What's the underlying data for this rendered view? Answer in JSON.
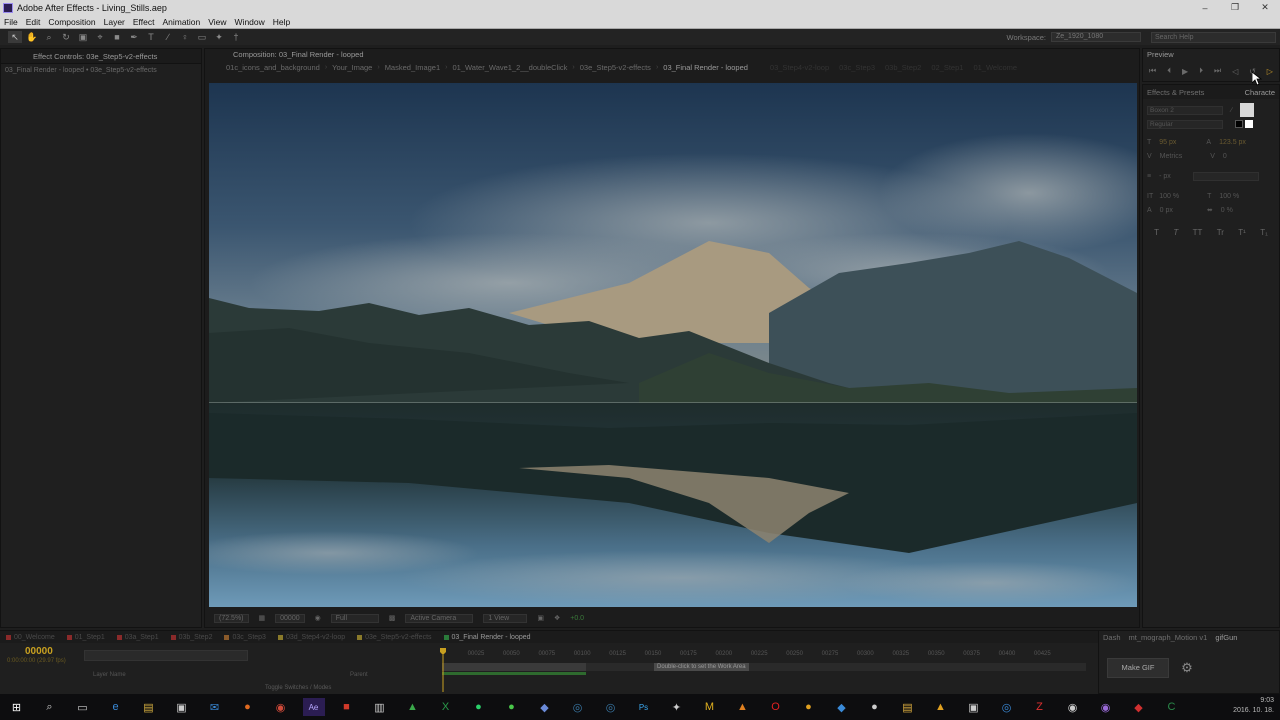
{
  "window": {
    "title": "Adobe After Effects - Living_Stills.aep",
    "controls": [
      "–",
      "❐",
      "✕"
    ]
  },
  "menu": [
    "File",
    "Edit",
    "Composition",
    "Layer",
    "Effect",
    "Animation",
    "View",
    "Window",
    "Help"
  ],
  "toolbar": {
    "workspace_label": "Workspace:",
    "workspace_value": "Ze_1920_1080",
    "search_placeholder": "Search Help"
  },
  "effect_controls": {
    "tab": "Effect Controls: 03e_Step5-v2-effects",
    "subtitle": "03_Final Render - looped • 03e_Step5-v2-effects"
  },
  "composition": {
    "tab": "Composition: 03_Final Render - looped",
    "breadcrumbs": [
      "01c_icons_and_background",
      "Your_Image",
      "Masked_Image1",
      "01_Water_Wave1_2__doubleClick",
      "03e_Step5-v2-effects",
      "03_Final Render - looped"
    ],
    "faded_crumbs": [
      "03_Step4-v2-loop",
      "03c_Step3",
      "03b_Step2",
      "02_Step1",
      "01_Welcome"
    ],
    "footer": {
      "zoom": "(72.5%)",
      "timecode": "00000",
      "resolution": "Full",
      "camera": "Active Camera",
      "views": "1 View",
      "exposure": "+0.0"
    }
  },
  "preview": {
    "tab": "Preview"
  },
  "character": {
    "tabs": [
      "Effects & Presets",
      "Characte"
    ],
    "font": "Boxon 2",
    "style": "Regular",
    "size": "95 px",
    "leading": "123.5 px",
    "kerning": "Metrics",
    "tracking": "0",
    "stroke_unit": "- px",
    "vscale": "100 %",
    "hscale": "100 %",
    "baseline": "0 px",
    "tsume": "0 %",
    "styles": [
      "T",
      "T",
      "TT",
      "Tr",
      "T¹",
      "T₁"
    ]
  },
  "timeline": {
    "tabs": [
      {
        "label": "00_Welcome",
        "color": "#8a2a2a"
      },
      {
        "label": "01_Step1",
        "color": "#8a2a2a"
      },
      {
        "label": "03a_Step1",
        "color": "#8a2a2a"
      },
      {
        "label": "03b_Step2",
        "color": "#8a2a2a"
      },
      {
        "label": "03c_Step3",
        "color": "#8a5a2a"
      },
      {
        "label": "03d_Step4-v2-loop",
        "color": "#8a7a2a"
      },
      {
        "label": "03e_Step5-v2-effects",
        "color": "#8a7a2a"
      },
      {
        "label": "03_Final Render - looped",
        "color": "#2a7a3a"
      }
    ],
    "timecode": "00000",
    "timecode_sub": "0:00:00:00 (29.97 fps)",
    "ruler": [
      "00025",
      "00050",
      "00075",
      "00100",
      "00125",
      "00150",
      "00175",
      "00200",
      "00225",
      "00250",
      "00275",
      "00300",
      "00325",
      "00350",
      "00375",
      "00400",
      "00425"
    ],
    "work_area_tip": "Double-click to set the Work Area",
    "columns": {
      "layer_name": "Layer Name",
      "parent": "Parent"
    },
    "toggle": "Toggle Switches / Modes"
  },
  "gif_panel": {
    "tabs": [
      "Dash",
      "mt_mograph_Motion v1",
      "gifGun"
    ],
    "button": "Make GIF"
  },
  "taskbar": {
    "time": "9:03",
    "date": "2016. 10. 18."
  },
  "colors": {
    "accent": "#c8a020",
    "titlebar": "#d9d9d9",
    "panel": "#1f1f1f"
  }
}
